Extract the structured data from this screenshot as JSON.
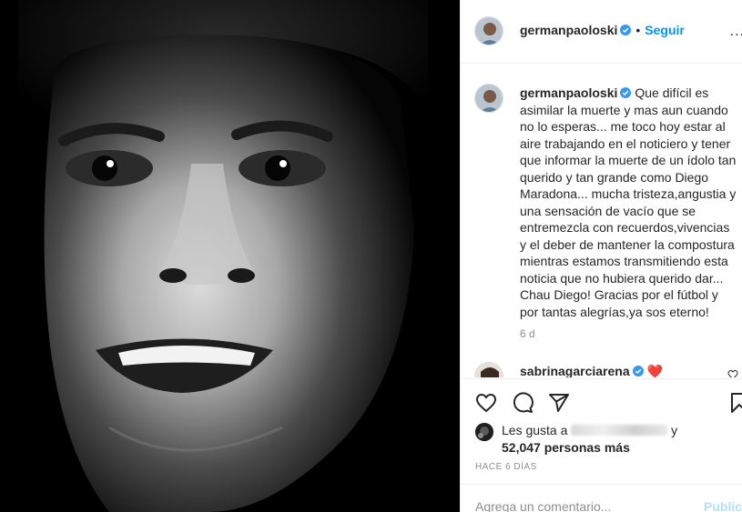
{
  "post": {
    "photo_alt": "",
    "author": {
      "username": "germanpaoloski",
      "verified_icon": "verified-badge-icon"
    },
    "header": {
      "dot": "•",
      "follow_label": "Seguir",
      "more_label": "..."
    },
    "caption": {
      "username": "germanpaoloski",
      "text": "Que difícil es asimilar la muerte y mas aun cuando no lo esperas... me toco hoy estar al aire trabajando en el noticiero y tener que informar la muerte de un ídolo tan querido y tan grande como Diego Maradona... mucha tristeza,angustia y una sensación de vacío que se entremezcla con recuerdos,vivencias y el deber de mantener la compostura mientras estamos transmitiendo esta noticia que no hubiera querido dar... Chau Diego! Gracias por el fútbol y por tantas alegrías,ya sos eterno!",
      "time": "6 d"
    },
    "next_comment": {
      "username": "sabrinagarciarena",
      "emoji": "❤️"
    },
    "likes": {
      "prefix": "Les gusta a",
      "suffix": "y",
      "count_text": "52,047 personas más"
    },
    "posted_ago": "HACE 6 DÍAS",
    "comment_box": {
      "placeholder": "Agrega un comentario...",
      "publish_label": "Publicar"
    }
  },
  "colors": {
    "link": "#0095f6",
    "publish_disabled": "#b2dffc",
    "secondary_text": "#8e8e8e",
    "heart_red": "#ed4956"
  }
}
